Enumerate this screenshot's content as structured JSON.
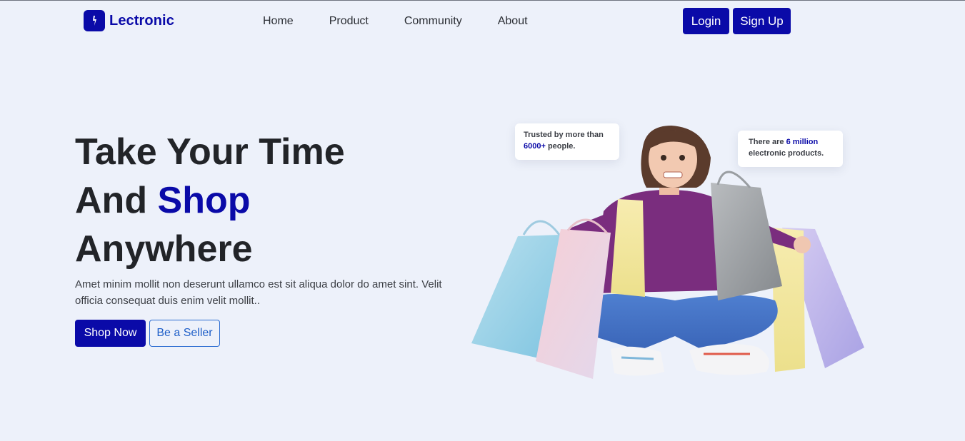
{
  "brand": {
    "name": "Lectronic",
    "icon": "lightning-bolt-icon"
  },
  "nav": {
    "links": [
      "Home",
      "Product",
      "Community",
      "About"
    ],
    "login_label": "Login",
    "signup_label": "Sign Up"
  },
  "hero": {
    "title_line1": "Take Your Time",
    "title_line2_prefix": "And ",
    "title_line2_accent": "Shop",
    "title_line3": "Anywhere",
    "description": "Amet minim mollit non deserunt ullamco est sit aliqua dolor do amet sint. Velit officia consequat duis enim velit mollit..",
    "shop_label": "Shop Now",
    "seller_label": "Be a Seller"
  },
  "cards": {
    "trusted_prefix": "Trusted by more than ",
    "trusted_highlight": "6000+",
    "trusted_suffix": " people.",
    "products_prefix": "There are ",
    "products_highlight": "6 million",
    "products_suffix": " electronic products."
  },
  "colors": {
    "accent": "#0a0aa8",
    "background": "#edf1fa",
    "outline_button": "#2a6bd1"
  }
}
